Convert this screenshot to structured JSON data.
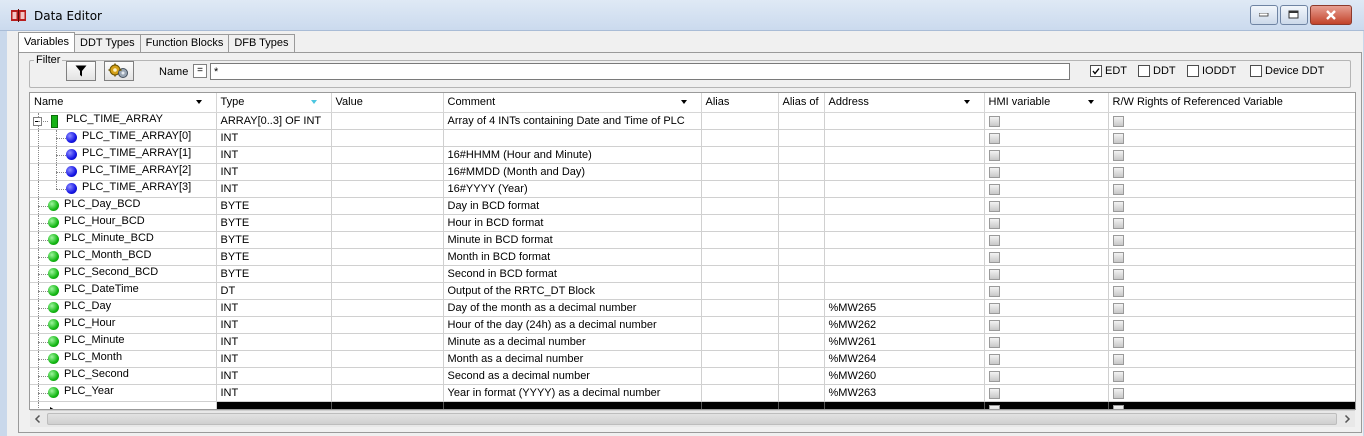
{
  "window": {
    "title": "Data Editor"
  },
  "tabs": [
    {
      "label": "Variables",
      "active": true
    },
    {
      "label": "DDT Types",
      "active": false
    },
    {
      "label": "Function Blocks",
      "active": false
    },
    {
      "label": "DFB Types",
      "active": false
    }
  ],
  "filter": {
    "legend": "Filter",
    "name_label": "Name",
    "eq_label": "=",
    "name_value": "*",
    "checkboxes": [
      {
        "label": "EDT",
        "checked": true
      },
      {
        "label": "DDT",
        "checked": false
      },
      {
        "label": "IODDT",
        "checked": false
      },
      {
        "label": "Device DDT",
        "checked": false
      }
    ]
  },
  "table": {
    "columns": [
      "Name",
      "Type",
      "Value",
      "Comment",
      "Alias",
      "Alias of",
      "Address",
      "HMI variable",
      "R/W Rights of Referenced Variable"
    ],
    "rows": [
      {
        "name": "PLC_TIME_ARRAY",
        "type": "ARRAY[0..3] OF INT",
        "value": "",
        "comment": "Array of 4 INTs containing Date and Time of PLC",
        "alias": "",
        "alias_of": "",
        "address": ""
      },
      {
        "name": "PLC_TIME_ARRAY[0]",
        "type": "INT",
        "value": "",
        "comment": "",
        "alias": "",
        "alias_of": "",
        "address": ""
      },
      {
        "name": "PLC_TIME_ARRAY[1]",
        "type": "INT",
        "value": "",
        "comment": "16#HHMM (Hour and Minute)",
        "alias": "",
        "alias_of": "",
        "address": ""
      },
      {
        "name": "PLC_TIME_ARRAY[2]",
        "type": "INT",
        "value": "",
        "comment": "16#MMDD (Month and Day)",
        "alias": "",
        "alias_of": "",
        "address": ""
      },
      {
        "name": "PLC_TIME_ARRAY[3]",
        "type": "INT",
        "value": "",
        "comment": "16#YYYY (Year)",
        "alias": "",
        "alias_of": "",
        "address": ""
      },
      {
        "name": "PLC_Day_BCD",
        "type": "BYTE",
        "value": "",
        "comment": "Day in BCD format",
        "alias": "",
        "alias_of": "",
        "address": ""
      },
      {
        "name": "PLC_Hour_BCD",
        "type": "BYTE",
        "value": "",
        "comment": "Hour in BCD format",
        "alias": "",
        "alias_of": "",
        "address": ""
      },
      {
        "name": "PLC_Minute_BCD",
        "type": "BYTE",
        "value": "",
        "comment": "Minute in BCD format",
        "alias": "",
        "alias_of": "",
        "address": ""
      },
      {
        "name": "PLC_Month_BCD",
        "type": "BYTE",
        "value": "",
        "comment": "Month in BCD format",
        "alias": "",
        "alias_of": "",
        "address": ""
      },
      {
        "name": "PLC_Second_BCD",
        "type": "BYTE",
        "value": "",
        "comment": "Second in BCD format",
        "alias": "",
        "alias_of": "",
        "address": ""
      },
      {
        "name": "PLC_DateTime",
        "type": "DT",
        "value": "",
        "comment": "Output of the RRTC_DT Block",
        "alias": "",
        "alias_of": "",
        "address": ""
      },
      {
        "name": "PLC_Day",
        "type": "INT",
        "value": "",
        "comment": "Day of the month as a decimal number",
        "alias": "",
        "alias_of": "",
        "address": "%MW265"
      },
      {
        "name": "PLC_Hour",
        "type": "INT",
        "value": "",
        "comment": "Hour of the day (24h) as a decimal number",
        "alias": "",
        "alias_of": "",
        "address": "%MW262"
      },
      {
        "name": "PLC_Minute",
        "type": "INT",
        "value": "",
        "comment": "Minute as a decimal number",
        "alias": "",
        "alias_of": "",
        "address": "%MW261"
      },
      {
        "name": "PLC_Month",
        "type": "INT",
        "value": "",
        "comment": "Month as a decimal number",
        "alias": "",
        "alias_of": "",
        "address": "%MW264"
      },
      {
        "name": "PLC_Second",
        "type": "INT",
        "value": "",
        "comment": "Second as a decimal number",
        "alias": "",
        "alias_of": "",
        "address": "%MW260"
      },
      {
        "name": "PLC_Year",
        "type": "INT",
        "value": "",
        "comment": "Year in format (YYYY) as a decimal number",
        "alias": "",
        "alias_of": "",
        "address": "%MW263"
      }
    ]
  },
  "icons": {
    "app": "data-editor-icon",
    "filter_button": "funnel-icon",
    "settings_button": "gears-icon",
    "array_node": "array-variable-icon",
    "element_node": "blue-dot-icon",
    "variable_node": "green-dot-icon",
    "hmi_cell": "hmi-checkbox-icon"
  },
  "colors": {
    "accent_green": "#14b814",
    "accent_blue": "#1515e6",
    "sort_arrow": "#4cc6e0",
    "close_button": "#c2432a"
  }
}
